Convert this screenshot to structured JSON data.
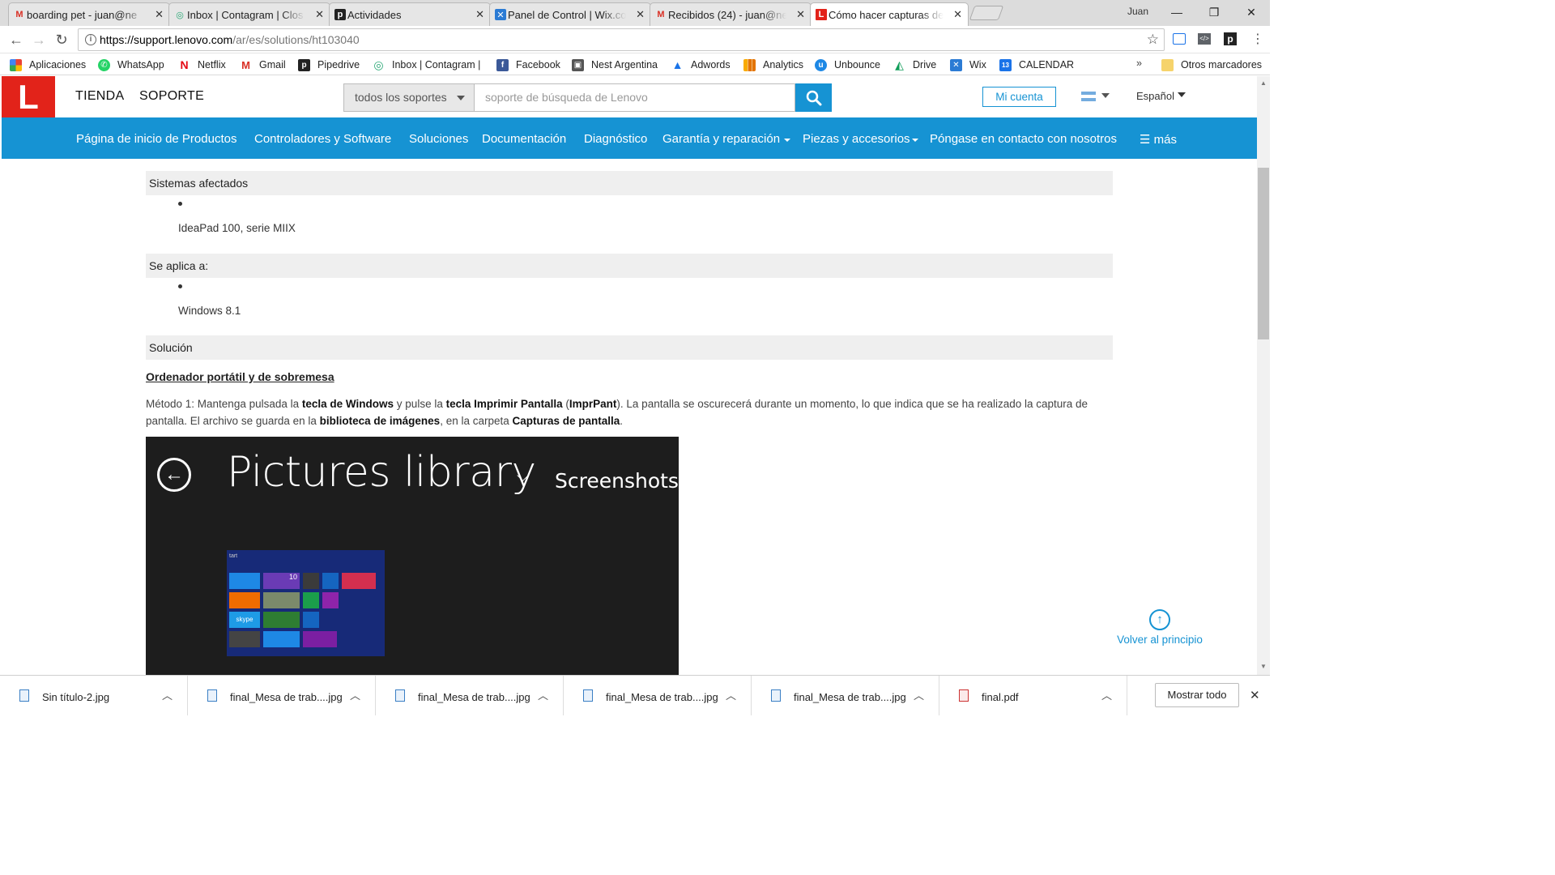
{
  "browser": {
    "tabs": [
      {
        "title": "boarding pet - juan@ne",
        "favicon": "gmail-icon"
      },
      {
        "title": "Inbox | Contagram | Clos",
        "favicon": "contagram-icon"
      },
      {
        "title": "Actividades",
        "favicon": "pipedrive-icon"
      },
      {
        "title": "Panel de Control | Wix.co",
        "favicon": "wix-icon"
      },
      {
        "title": "Recibidos (24) - juan@ne",
        "favicon": "gmail-icon"
      },
      {
        "title": "Cómo hacer capturas de",
        "favicon": "lenovo-icon"
      }
    ],
    "user": "Juan",
    "url_host": "https://support.lenovo.com",
    "url_path": "/ar/es/solutions/ht103040",
    "bookmarks": [
      {
        "label": "Aplicaciones",
        "icon": "apps-grid-icon",
        "color": "#e94235"
      },
      {
        "label": "WhatsApp",
        "icon": "whatsapp-icon",
        "color": "#25d366"
      },
      {
        "label": "Netflix",
        "icon": "netflix-icon",
        "color": "#e50914"
      },
      {
        "label": "Gmail",
        "icon": "gmail-icon",
        "color": "#d93025"
      },
      {
        "label": "Pipedrive",
        "icon": "pipedrive-icon",
        "color": "#222222"
      },
      {
        "label": "Inbox | Contagram |",
        "icon": "contagram-icon",
        "color": "#2aa876"
      },
      {
        "label": "Facebook",
        "icon": "facebook-icon",
        "color": "#3b5998"
      },
      {
        "label": "Nest Argentina",
        "icon": "nest-icon",
        "color": "#555555"
      },
      {
        "label": "Adwords",
        "icon": "adwords-icon",
        "color": "#1a73e8"
      },
      {
        "label": "Analytics",
        "icon": "analytics-icon",
        "color": "#f9ab00"
      },
      {
        "label": "Unbounce",
        "icon": "unbounce-icon",
        "color": "#1e88e5"
      },
      {
        "label": "Drive",
        "icon": "drive-icon",
        "color": "#0f9d58"
      },
      {
        "label": "Wix",
        "icon": "wix-icon",
        "color": "#2b7bd4"
      },
      {
        "label": "CALENDAR",
        "icon": "calendar-icon",
        "color": "#1a73e8"
      }
    ],
    "more_bookmarks": "»",
    "other_bookmarks": "Otros marcadores"
  },
  "site": {
    "logo": "L",
    "nav_left": [
      "TIENDA",
      "SOPORTE"
    ],
    "search_scope": "todos los soportes",
    "search_placeholder": "soporte de búsqueda de Lenovo",
    "account_label": "Mi cuenta",
    "language": "Español",
    "main_nav": [
      "Página de inicio de Productos",
      "Controladores y Software",
      "Soluciones",
      "Documentación",
      "Diagnóstico",
      "Garantía y reparación",
      "Piezas y accesorios",
      "Póngase en contacto con nosotros",
      "más"
    ],
    "brand_color": "#e2231a",
    "accent_color": "#1693d3"
  },
  "article": {
    "sections": [
      {
        "heading": "Sistemas afectados",
        "items": [
          "IdeaPad 100, serie MIIX"
        ]
      },
      {
        "heading": "Se aplica a:",
        "items": [
          "Windows 8.1"
        ]
      },
      {
        "heading": "Solución"
      }
    ],
    "subheading": "Ordenador portátil y de sobremesa",
    "method_parts": [
      {
        "t": "Método 1: Mantenga pulsada la ",
        "b": false
      },
      {
        "t": "tecla de Windows",
        "b": true
      },
      {
        "t": " y pulse la ",
        "b": false
      },
      {
        "t": "tecla Imprimir Pantalla",
        "b": true
      },
      {
        "t": " (",
        "b": false
      },
      {
        "t": "ImprPant",
        "b": true
      },
      {
        "t": "). La pantalla se oscurecerá durante un momento, lo que indica que se ha realizado la captura de pantalla. El archivo se guarda en la ",
        "b": false
      },
      {
        "t": "biblioteca de imágenes",
        "b": true
      },
      {
        "t": ", en la carpeta ",
        "b": false
      },
      {
        "t": "Capturas de pantalla",
        "b": true
      },
      {
        "t": ".",
        "b": false
      }
    ],
    "screenshot": {
      "title": "Pictures library",
      "subtitle": "Screenshots",
      "thumb_start_label": "tart",
      "thumb_tile_number": "10",
      "thumb_skype_label": "skype"
    },
    "back_to_top": "Volver al principio"
  },
  "downloads": {
    "files": [
      {
        "name": "Sin título-2.jpg",
        "type": "jpg"
      },
      {
        "name": "final_Mesa de trab....jpg",
        "type": "jpg"
      },
      {
        "name": "final_Mesa de trab....jpg",
        "type": "jpg"
      },
      {
        "name": "final_Mesa de trab....jpg",
        "type": "jpg"
      },
      {
        "name": "final_Mesa de trab....jpg",
        "type": "jpg"
      },
      {
        "name": "final.pdf",
        "type": "pdf"
      }
    ],
    "show_all": "Mostrar todo"
  }
}
